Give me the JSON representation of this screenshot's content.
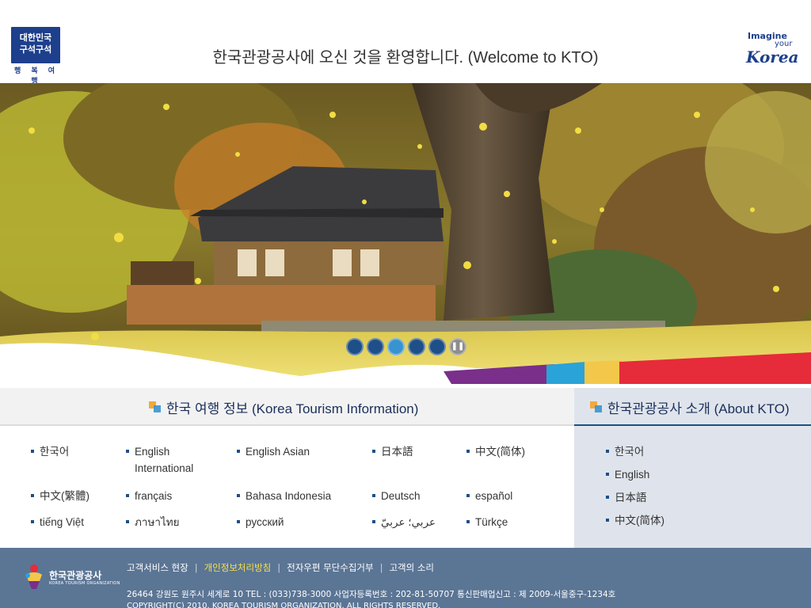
{
  "header": {
    "left_logo": {
      "lines": [
        "대한민국",
        "구석구석"
      ],
      "sub": "행 복 여 행"
    },
    "welcome": "한국관광공사에 오신 것을 환영합니다. (Welcome to KTO)",
    "right_logo": {
      "line1": "Imagine",
      "line2": "your",
      "line3": "Korea"
    }
  },
  "hero": {
    "slide_dots": 5,
    "active_dot": 3,
    "pause_icon": "pause-icon"
  },
  "tourism_info": {
    "title": "한국 여행 정보 (Korea Tourism Information)",
    "links": [
      "한국어",
      "English International",
      "English Asian",
      "日本語",
      "中文(简体)",
      "中文(繁體)",
      "français",
      "Bahasa Indonesia",
      "Deutsch",
      "español",
      "tiếng Việt",
      "ภาษาไทย",
      "русский",
      "عربي؛ عربيّ",
      "Türkçe"
    ]
  },
  "about_kto": {
    "title": "한국관광공사 소개 (About KTO)",
    "links": [
      "한국어",
      "English",
      "日本語",
      "中文(简体)"
    ]
  },
  "footer": {
    "logo_text": "한국관광공사",
    "logo_sub": "KOREA TOURISM ORGANIZATION",
    "links": [
      "고객서비스 현장",
      "개인정보처리방침",
      "전자우편 무단수집거부",
      "고객의 소리"
    ],
    "address": "26464 강원도 원주시 세계로 10 TEL : (033)738-3000 사업자등록번호 : 202-81-50707 통신판매업신고 : 제 2009-서울중구-1234호",
    "copyright": "COPYRIGHT(C) 2010. KOREA TOURISM ORGANIZATION. ALL RIGHTS RESERVED."
  },
  "colors": {
    "brand_blue": "#1d3f8c",
    "footer_bg": "#5b7595",
    "about_bg": "#dfe4ec",
    "highlight_link": "#f5e04a"
  }
}
